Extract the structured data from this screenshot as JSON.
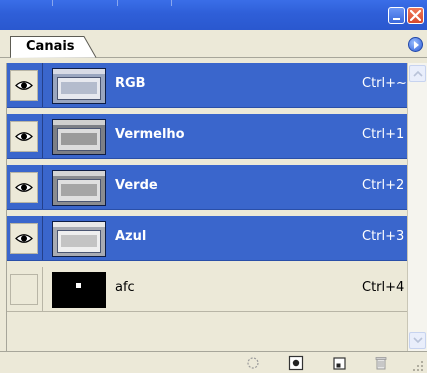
{
  "panel": {
    "tab_label": "Canais"
  },
  "channels": [
    {
      "name": "RGB",
      "shortcut": "Ctrl+~",
      "visible": true,
      "selected": true,
      "thumbnail": "screenshot-thumbnail"
    },
    {
      "name": "Vermelho",
      "shortcut": "Ctrl+1",
      "visible": true,
      "selected": true,
      "thumbnail": "screenshot-thumbnail"
    },
    {
      "name": "Verde",
      "shortcut": "Ctrl+2",
      "visible": true,
      "selected": true,
      "thumbnail": "screenshot-thumbnail"
    },
    {
      "name": "Azul",
      "shortcut": "Ctrl+3",
      "visible": true,
      "selected": true,
      "thumbnail": "screenshot-thumbnail"
    },
    {
      "name": "afc",
      "shortcut": "Ctrl+4",
      "visible": false,
      "selected": false,
      "thumbnail": "black-mask-thumbnail"
    }
  ],
  "bottom_toolbar": {
    "icons": [
      "load-selection-icon",
      "save-selection-icon",
      "new-channel-icon",
      "trash-icon"
    ]
  },
  "colors": {
    "titlebar": "#2f5fd8",
    "selection": "#3a66cc",
    "panel_bg": "#ece9d8",
    "close_button": "#d7492c"
  }
}
